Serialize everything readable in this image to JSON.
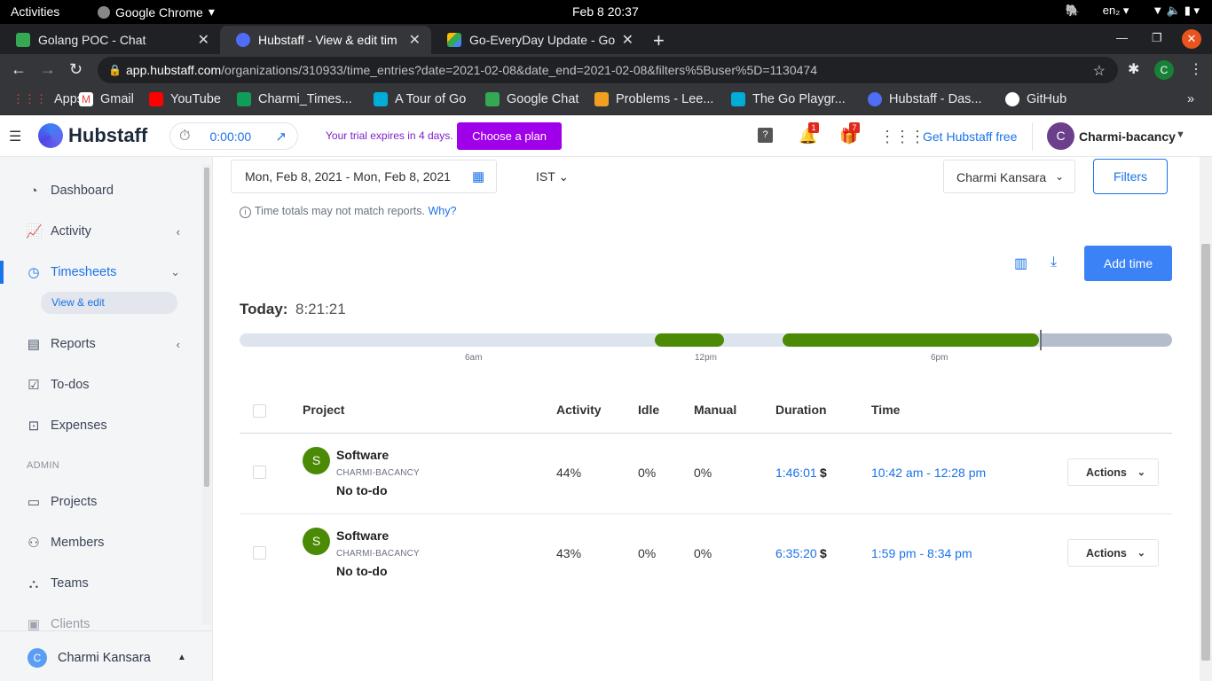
{
  "os": {
    "activities": "Activities",
    "app_menu": "Google Chrome",
    "clock": "Feb 8  20:37",
    "lang": "en₂"
  },
  "browser": {
    "tabs": [
      {
        "title": "Golang POC - Chat",
        "icon": "google-chat-icon",
        "color": "#34a853"
      },
      {
        "title": "Hubstaff - View & edit tim",
        "icon": "hubstaff-icon",
        "color": "#4f6df5"
      },
      {
        "title": "Go-EveryDay Update - Goo",
        "icon": "google-drive-icon",
        "color": "#fbbc04"
      }
    ],
    "url_host": "app.hubstaff.com",
    "url_path": "/organizations/310933/time_entries?date=2021-02-08&date_end=2021-02-08&filters%5Buser%5D=1130474",
    "profile_initial": "C",
    "bookmarks": [
      {
        "label": "Apps",
        "color": "#ea4335"
      },
      {
        "label": "Gmail",
        "color": "#ea4335"
      },
      {
        "label": "YouTube",
        "color": "#ff0000"
      },
      {
        "label": "Charmi_Times...",
        "color": "#0f9d58"
      },
      {
        "label": "A Tour of Go",
        "color": "#00add8"
      },
      {
        "label": "Google Chat",
        "color": "#34a853"
      },
      {
        "label": "Problems - Lee...",
        "color": "#f0a020"
      },
      {
        "label": "The Go Playgr...",
        "color": "#00add8"
      },
      {
        "label": "Hubstaff - Das...",
        "color": "#4f6df5"
      },
      {
        "label": "GitHub",
        "color": "#ffffff"
      }
    ]
  },
  "header": {
    "brand": "Hubstaff",
    "timer": "0:00:00",
    "trial_text": "Your trial expires in 4 days.",
    "plan_button": "Choose a plan",
    "notif_count": "1",
    "gift_count": "7",
    "free_link": "Get Hubstaff free",
    "user_initial": "C",
    "user_name": "Charmi-bacancy"
  },
  "sidebar": {
    "items": [
      {
        "label": "Dashboard",
        "icon": "dashboard-icon"
      },
      {
        "label": "Activity",
        "icon": "activity-icon"
      },
      {
        "label": "Timesheets",
        "icon": "clock-icon"
      },
      {
        "label": "Reports",
        "icon": "reports-icon"
      },
      {
        "label": "To-dos",
        "icon": "todo-icon"
      },
      {
        "label": "Expenses",
        "icon": "expenses-icon"
      }
    ],
    "subitem": "View & edit",
    "admin_label": "ADMIN",
    "admin_items": [
      {
        "label": "Projects",
        "icon": "folder-icon"
      },
      {
        "label": "Members",
        "icon": "members-icon"
      },
      {
        "label": "Teams",
        "icon": "teams-icon"
      },
      {
        "label": "Clients",
        "icon": "clients-icon"
      }
    ],
    "footer_user": "Charmi Kansara",
    "footer_initial": "C"
  },
  "main": {
    "date_range": "Mon, Feb 8, 2021 - Mon, Feb 8, 2021",
    "timezone": "IST",
    "user_filter": "Charmi Kansara",
    "filters_button": "Filters",
    "info_text": "Time totals may not match reports.",
    "why_link": "Why?",
    "add_time_button": "Add time",
    "today_label": "Today:",
    "today_total": "8:21:21",
    "timeline_ticks": [
      "6am",
      "12pm",
      "6pm"
    ],
    "table_headers": [
      "Project",
      "Activity",
      "Idle",
      "Manual",
      "Duration",
      "Time"
    ],
    "rows": [
      {
        "initial": "S",
        "project": "Software",
        "org": "CHARMI-BACANCY",
        "todo": "No to-do",
        "activity": "44%",
        "idle": "0%",
        "manual": "0%",
        "duration": "1:46:01",
        "currency": "$",
        "time": "10:42 am - 12:28 pm",
        "actions": "Actions"
      },
      {
        "initial": "S",
        "project": "Software",
        "org": "CHARMI-BACANCY",
        "todo": "No to-do",
        "activity": "43%",
        "idle": "0%",
        "manual": "0%",
        "duration": "6:35:20",
        "currency": "$",
        "time": "1:59 pm - 8:34 pm",
        "actions": "Actions"
      }
    ]
  }
}
